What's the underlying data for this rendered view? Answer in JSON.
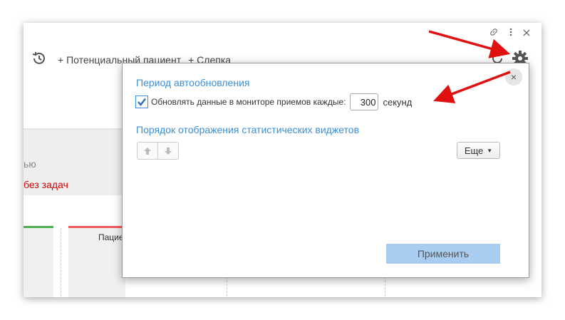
{
  "toolbar": {
    "new_patient": "+ Потенциальный пациент",
    "impression": "+ Слепка"
  },
  "background": {
    "partial_text1": "ью",
    "partial_text2": "без задач",
    "card_text": "Пацие"
  },
  "dialog": {
    "section1_title": "Период автообновления",
    "checkbox_label": "Обновлять данные в мониторе приемов каждые:",
    "checkbox_checked": true,
    "interval_value": "300",
    "interval_unit": "секунд",
    "section2_title": "Порядок отображения статистических виджетов",
    "more_label": "Еще",
    "apply_label": "Применить",
    "close_symbol": "×"
  },
  "icons": {
    "link": "link-icon",
    "menu": "more-vertical-icon",
    "close": "close-icon",
    "history": "history-icon",
    "refresh": "refresh-icon",
    "settings": "gear-icon",
    "up": "arrow-up-icon",
    "down": "arrow-down-icon"
  },
  "colors": {
    "accent": "#3b8fd6",
    "annotation_arrow": "#e01010",
    "apply_bg": "#a9cdf0"
  }
}
